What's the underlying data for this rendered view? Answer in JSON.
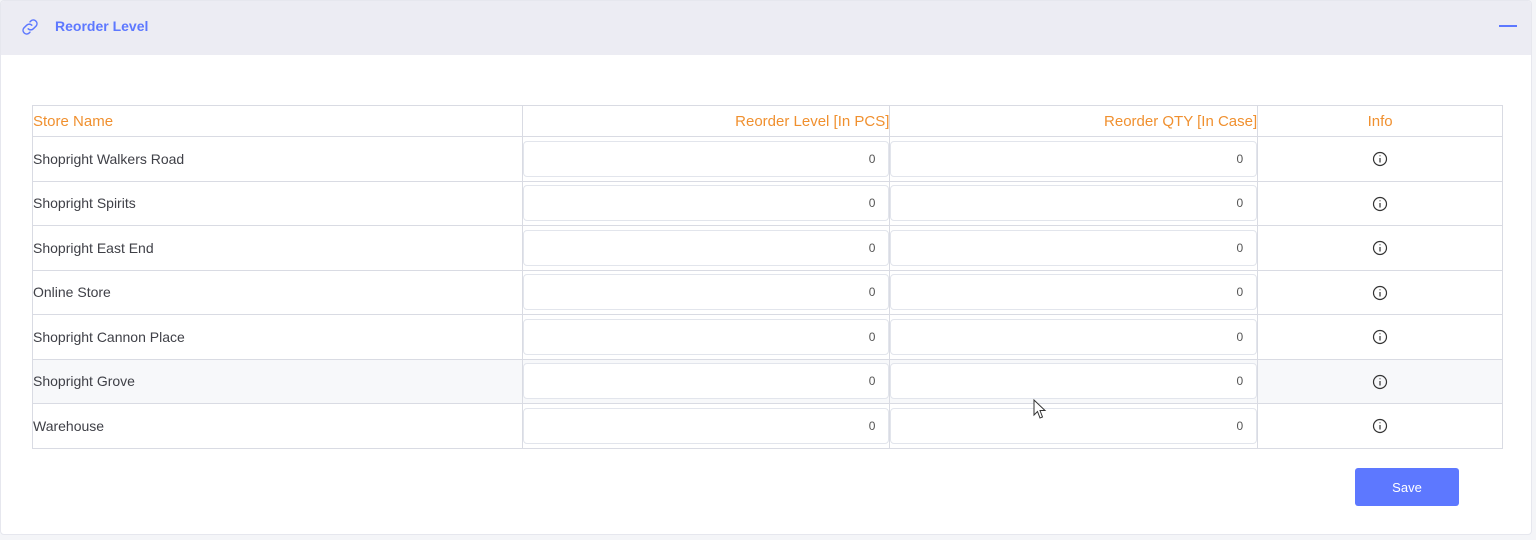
{
  "panel": {
    "title": "Reorder Level",
    "icon": "link-icon",
    "collapse_icon": "minus-icon"
  },
  "table": {
    "headers": {
      "store_name": "Store Name",
      "reorder_level": "Reorder Level [In PCS]",
      "reorder_qty": "Reorder QTY [In Case]",
      "info": "Info"
    },
    "rows": [
      {
        "store": "Shopright Walkers Road",
        "level": "0",
        "qty": "0"
      },
      {
        "store": "Shopright Spirits",
        "level": "0",
        "qty": "0"
      },
      {
        "store": "Shopright East End",
        "level": "0",
        "qty": "0"
      },
      {
        "store": "Online Store",
        "level": "0",
        "qty": "0"
      },
      {
        "store": "Shopright Cannon Place",
        "level": "0",
        "qty": "0"
      },
      {
        "store": "Shopright Grove",
        "level": "0",
        "qty": "0"
      },
      {
        "store": "Warehouse",
        "level": "0",
        "qty": "0"
      }
    ],
    "info_icon": "info-circle-icon"
  },
  "actions": {
    "save_label": "Save"
  },
  "colors": {
    "accent": "#5d78ff",
    "header_text": "#f0902f"
  }
}
